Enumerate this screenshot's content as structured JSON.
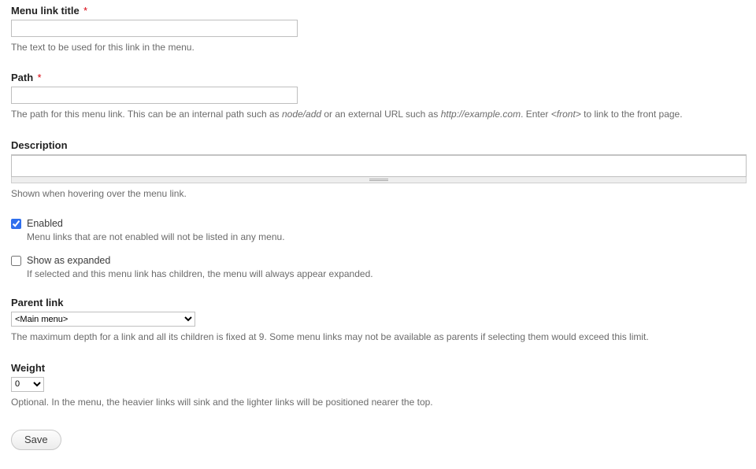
{
  "title_field": {
    "label": "Menu link title",
    "required": "*",
    "value": "",
    "help": "The text to be used for this link in the menu."
  },
  "path_field": {
    "label": "Path",
    "required": "*",
    "value": "",
    "help_pre": "The path for this menu link. This can be an internal path such as ",
    "help_em1": "node/add",
    "help_mid": " or an external URL such as ",
    "help_em2": "http://example.com",
    "help_post1": ". Enter ",
    "help_em3": "<front>",
    "help_post2": " to link to the front page."
  },
  "description_field": {
    "label": "Description",
    "value": "",
    "help": "Shown when hovering over the menu link."
  },
  "enabled": {
    "label": "Enabled",
    "checked": true,
    "help": "Menu links that are not enabled will not be listed in any menu."
  },
  "expanded": {
    "label": "Show as expanded",
    "checked": false,
    "help": "If selected and this menu link has children, the menu will always appear expanded."
  },
  "parent": {
    "label": "Parent link",
    "selected": "<Main menu>",
    "help": "The maximum depth for a link and all its children is fixed at 9. Some menu links may not be available as parents if selecting them would exceed this limit."
  },
  "weight": {
    "label": "Weight",
    "selected": "0",
    "help": "Optional. In the menu, the heavier links will sink and the lighter links will be positioned nearer the top."
  },
  "actions": {
    "save": "Save"
  }
}
